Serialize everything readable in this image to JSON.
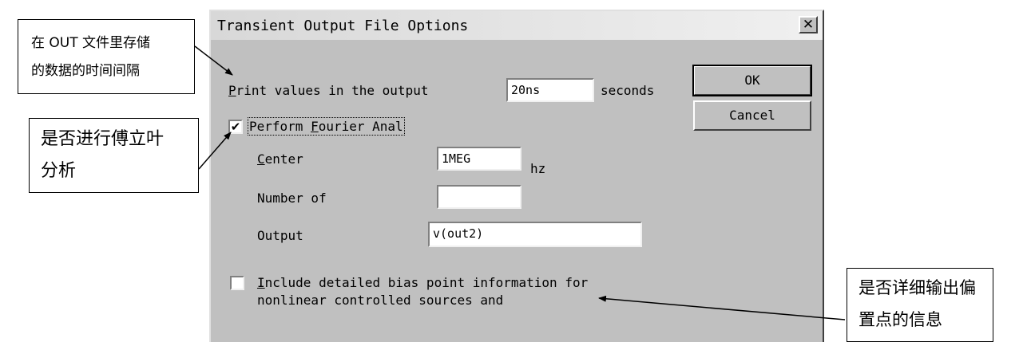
{
  "dialog": {
    "title": "Transient Output File Options",
    "close_glyph": "✕",
    "print_values": {
      "pre": "",
      "mnemonic": "P",
      "rest": "rint values in the output",
      "value": "20ns",
      "unit": "seconds"
    },
    "buttons": {
      "ok": "OK",
      "cancel": "Cancel"
    },
    "fourier": {
      "checked": true,
      "check_glyph": "✔",
      "pre": "Perform ",
      "mnemonic": "F",
      "rest": "ourier Anal",
      "center": {
        "mnemonic": "C",
        "rest": "enter",
        "value": "1MEG",
        "unit": "hz"
      },
      "number_of": {
        "label": "Number of",
        "value": ""
      },
      "output": {
        "label": "Output",
        "value": "v(out2)"
      }
    },
    "bias": {
      "checked": false,
      "mnemonic": "I",
      "line1_rest": "nclude detailed bias point information for",
      "line2": "nonlinear controlled sources and"
    }
  },
  "annotations": {
    "out_interval": {
      "line1": "在 OUT 文件里存储",
      "line2": "的数据的时间间隔"
    },
    "fourier": {
      "line1": "是否进行傅立叶",
      "line2": "分析"
    },
    "bias": {
      "line1": "是否详细输出偏",
      "line2": "置点的信息"
    }
  }
}
